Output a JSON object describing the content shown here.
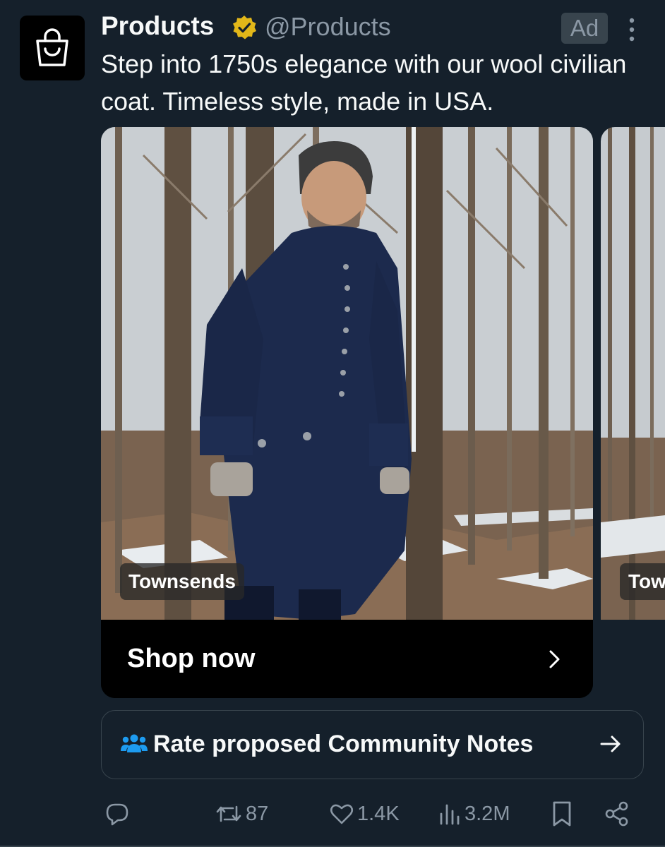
{
  "post": {
    "account_name": "Products",
    "handle": "@Products",
    "ad_label": "Ad",
    "text": "Step into 1750s elegance with our wool civilian coat. Timeless style, made in USA."
  },
  "card": {
    "brand": "Townsends",
    "cta": "Shop now",
    "next_brand": "Townsends"
  },
  "community_notes": {
    "label": "Rate proposed Community Notes"
  },
  "actions": {
    "reposts": "87",
    "likes": "1.4K",
    "views": "3.2M"
  },
  "colors": {
    "background": "#15202b",
    "secondary_text": "#8b98a5",
    "verified_gold": "#e2b719",
    "notes_blue": "#1d9bf0"
  },
  "icons": [
    "shopping-bag-icon",
    "verified-badge-icon",
    "more-icon",
    "chevron-right-icon",
    "community-notes-icon",
    "arrow-right-icon",
    "reply-icon",
    "repost-icon",
    "like-icon",
    "views-icon",
    "bookmark-icon",
    "share-icon"
  ]
}
